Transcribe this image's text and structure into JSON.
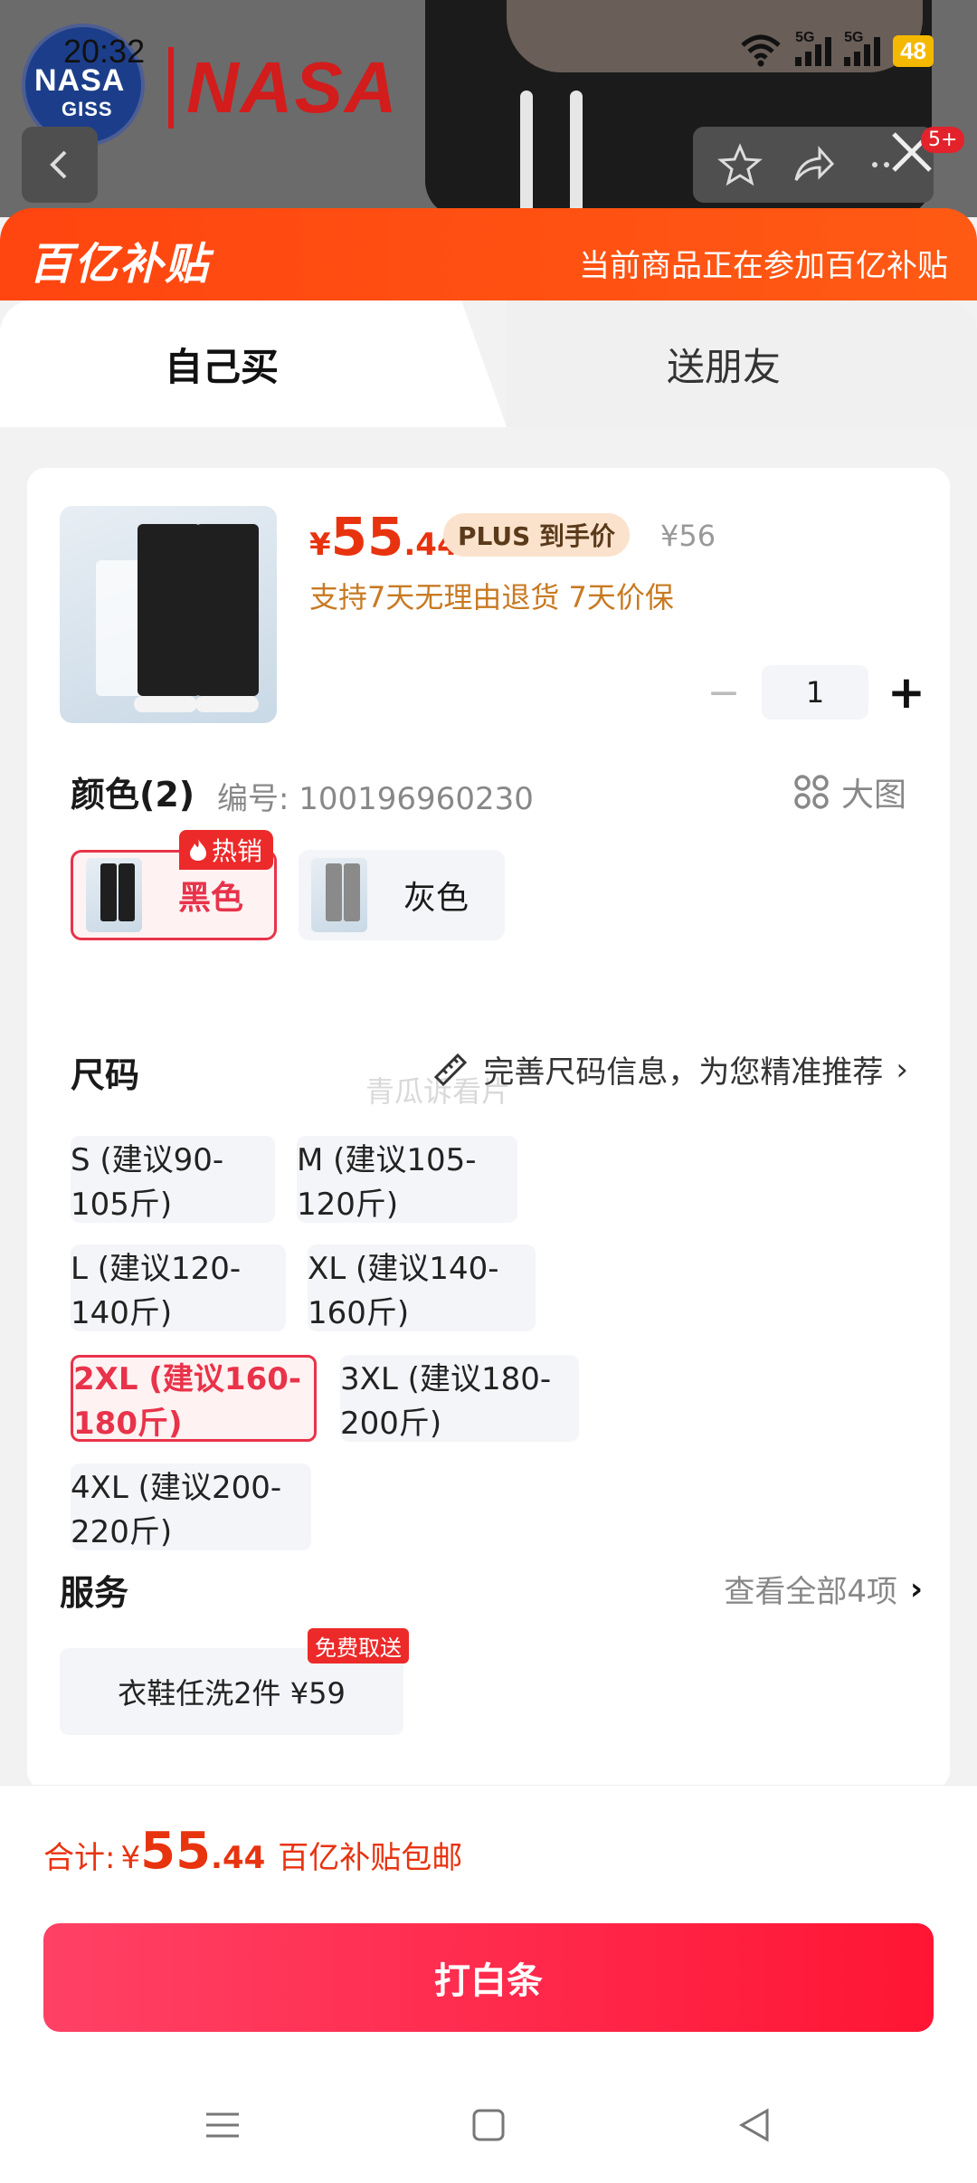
{
  "status": {
    "time": "20:32",
    "battery": "48",
    "sig1": "5G",
    "sig2": "5G"
  },
  "brand": {
    "circle": "NASA",
    "circle_sub": "GISS",
    "word": "NASA"
  },
  "top": {
    "badge": "5+"
  },
  "banner": {
    "logo": "百亿补贴",
    "text": "当前商品正在参加百亿补贴"
  },
  "tabs": {
    "self": "自己买",
    "gift": "送朋友"
  },
  "product": {
    "price_symbol": "¥",
    "price_int": "55",
    "price_dec": ".44",
    "plus_tag": "PLUS 到手价",
    "original_price": "¥56",
    "services": "支持7天无理由退货  7天价保",
    "quantity": "1",
    "minus": "−",
    "plus": "+"
  },
  "color": {
    "title": "颜色(2)",
    "code": "编号: 100196960230",
    "bigpic": "大图",
    "hot": "热销",
    "options": [
      "黑色",
      "灰色"
    ]
  },
  "size": {
    "title": "尺码",
    "recommend": "完善尺码信息，为您精准推荐",
    "watermark": "青瓜诉看片",
    "options": [
      "S (建议90-105斤)",
      "M (建议105-120斤)",
      "L (建议120-140斤)",
      "XL (建议140-160斤)",
      "2XL (建议160-180斤)",
      "3XL (建议180-200斤)",
      "4XL (建议200-220斤)"
    ],
    "selected": "2XL (建议160-180斤)"
  },
  "service": {
    "title": "服务",
    "view_all": "查看全部4项",
    "item": "衣鞋任洗2件  ¥59",
    "tag": "免费取送"
  },
  "footer": {
    "total_label": "合计:",
    "cur": "¥",
    "int": "55",
    "dec": ".44",
    "shipping": "百亿补贴包邮",
    "pay_button": "打白条"
  },
  "colors": {
    "accent": "#e8334a",
    "price": "#e8330f",
    "banner": "#ff4510"
  }
}
